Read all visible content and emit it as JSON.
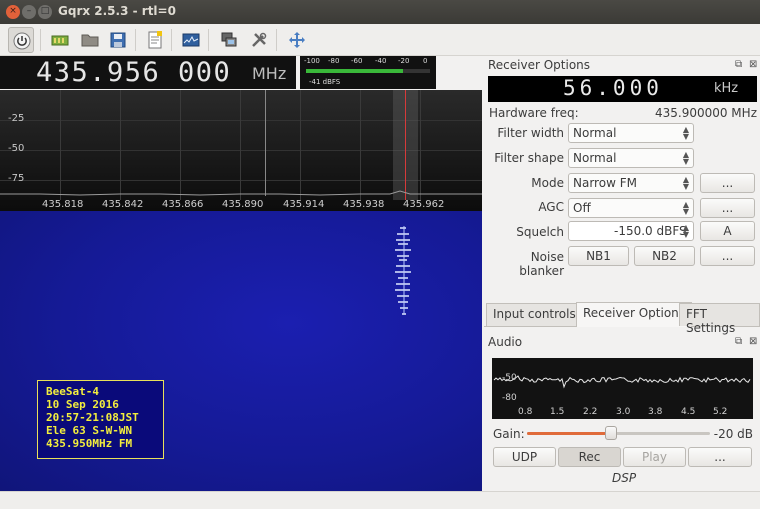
{
  "window": {
    "title": "Gqrx 2.5.3 - rtl=0",
    "close_glyph": "×",
    "min_glyph": "–",
    "max_glyph": "□"
  },
  "toolbar": {
    "icons": [
      "power-icon",
      "hardware-icon",
      "open-folder-icon",
      "save-icon",
      "notes-icon",
      "spectrum-icon",
      "network-icon",
      "tools-icon",
      "fullscreen-icon"
    ]
  },
  "frequency": {
    "value": "435.956 000",
    "unit": "MHz"
  },
  "meter": {
    "ticks": [
      "-100",
      "-80",
      "-60",
      "-40",
      "-20",
      "0"
    ],
    "reading": "-41 dBFS",
    "level_fraction": 0.78
  },
  "spectrum": {
    "db_labels": [
      "-25",
      "-50",
      "-75"
    ],
    "freq_labels": [
      "435.818",
      "435.842",
      "435.866",
      "435.890",
      "435.914",
      "435.938",
      "435.962"
    ]
  },
  "waterfall": {
    "annotation": [
      "BeeSat-4",
      "10 Sep 2016",
      "20:57-21:08JST",
      "Ele 63 S-W-WN",
      "435.950MHz FM"
    ]
  },
  "receiver": {
    "panel_title": "Receiver Options",
    "offset": "56.000",
    "offset_unit": "kHz",
    "hw_freq_label": "Hardware freq:",
    "hw_freq_value": "435.900000 MHz",
    "filter_width_label": "Filter width",
    "filter_width_value": "Normal",
    "filter_shape_label": "Filter shape",
    "filter_shape_value": "Normal",
    "mode_label": "Mode",
    "mode_value": "Narrow FM",
    "mode_options_btn": "...",
    "agc_label": "AGC",
    "agc_value": "Off",
    "agc_options_btn": "...",
    "squelch_label": "Squelch",
    "squelch_value": "-150.0 dBFS",
    "squelch_auto_btn": "A",
    "nb_label": "Noise blanker",
    "nb1": "NB1",
    "nb2": "NB2",
    "nb_options_btn": "..."
  },
  "tabs": [
    {
      "label": "Input controls",
      "active": false
    },
    {
      "label": "Receiver Options",
      "active": true
    },
    {
      "label": "FFT Settings",
      "active": false
    }
  ],
  "audio": {
    "panel_title": "Audio",
    "db_labels": [
      "-50",
      "-80"
    ],
    "freq_labels": [
      "0.8",
      "1.5",
      "2.2",
      "3.0",
      "3.8",
      "4.5",
      "5.2"
    ],
    "gain_label": "Gain:",
    "gain_value": "-20 dB",
    "gain_fraction": 0.46,
    "udp": "UDP",
    "rec": "Rec",
    "play": "Play",
    "options": "...",
    "footer": "DSP"
  },
  "colors": {
    "accent": "#e06b3a",
    "waterfall": "#151a96",
    "annotation_text": "#f3ee3d"
  }
}
